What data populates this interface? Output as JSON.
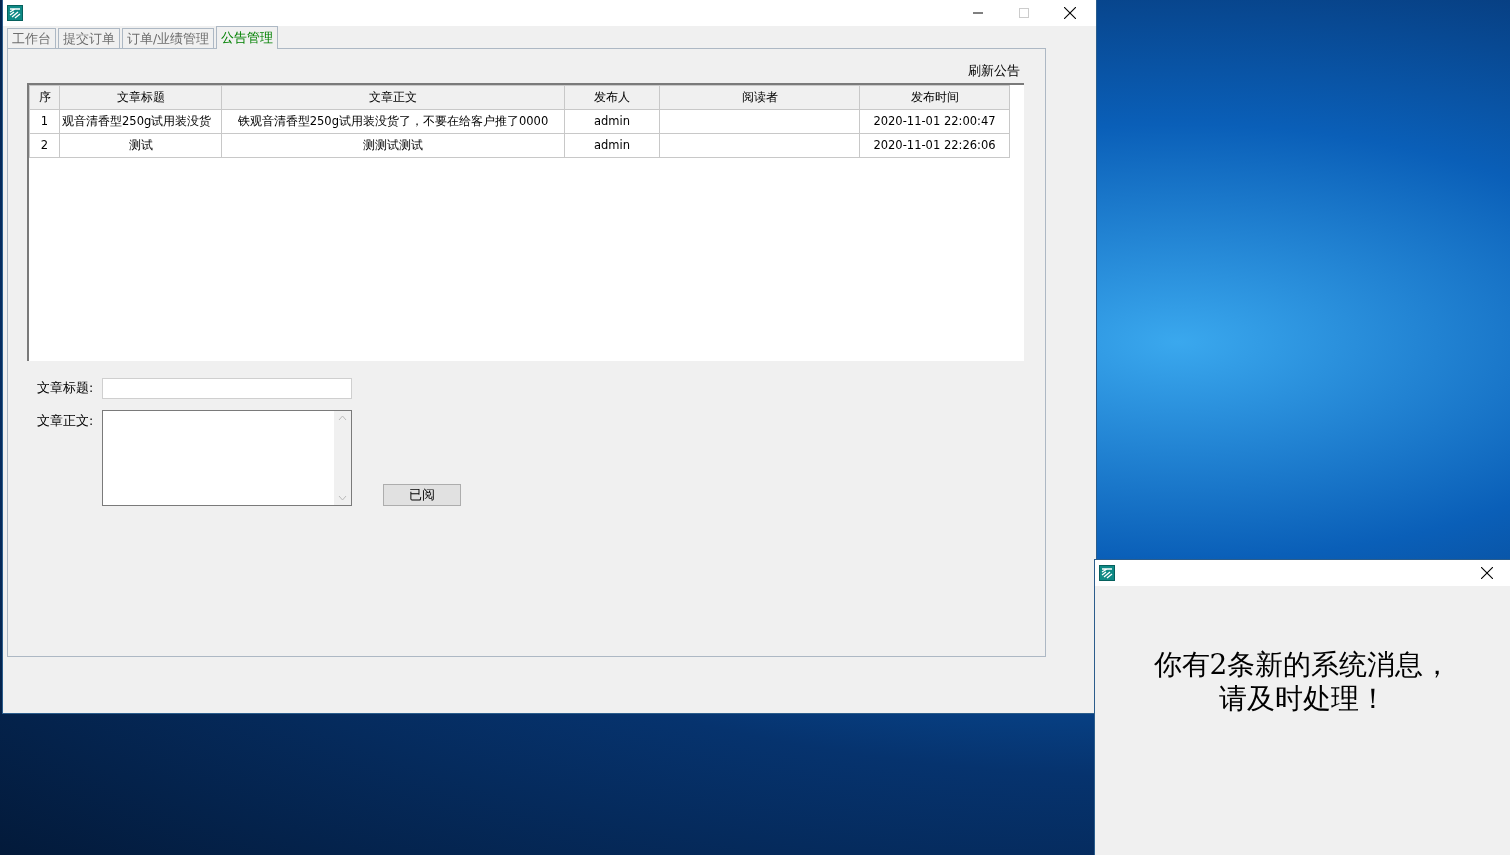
{
  "main_window": {
    "title_bar": {
      "buttons": [
        {
          "kind": "minimize"
        },
        {
          "kind": "maximize"
        },
        {
          "kind": "close"
        }
      ]
    },
    "tabs": [
      {
        "label": "工作台",
        "selected": false
      },
      {
        "label": "提交订单",
        "selected": false
      },
      {
        "label": "订单/业绩管理",
        "selected": false
      },
      {
        "label": "公告管理",
        "selected": true
      }
    ],
    "refresh_link": "刷新公告",
    "table": {
      "columns": [
        "序",
        "文章标题",
        "文章正文",
        "发布人",
        "阅读者",
        "发布时间"
      ],
      "rows": [
        [
          "1",
          "观音清香型250g试用装没货",
          "铁观音清香型250g试用装没货了，不要在给客户推了0000",
          "admin",
          "",
          "2020-11-01 22:00:47"
        ],
        [
          "2",
          "测试",
          "测测试测试",
          "admin",
          "",
          "2020-11-01 22:26:06"
        ]
      ]
    },
    "form": {
      "title_label": "文章标题:",
      "body_label": "文章正文:",
      "button": "已阅"
    }
  },
  "notification": {
    "message_lines": [
      "你有2条新的系统消息，",
      "请及时处理！"
    ]
  }
}
